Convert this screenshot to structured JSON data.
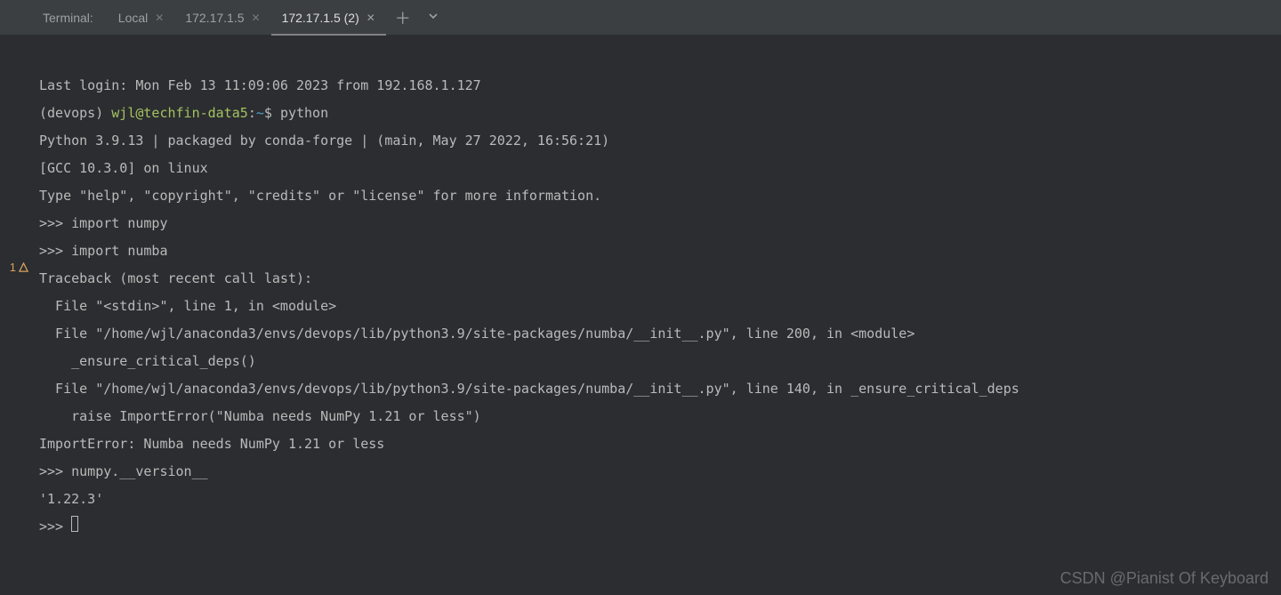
{
  "tabbar": {
    "label": "Terminal:",
    "tabs": [
      {
        "label": "Local"
      },
      {
        "label": "172.17.1.5"
      },
      {
        "label": "172.17.1.5 (2)"
      }
    ]
  },
  "gutter": {
    "count": "1"
  },
  "term": {
    "line1": "Last login: Mon Feb 13 11:09:06 2023 from 192.168.1.127",
    "prompt_env": "(devops) ",
    "prompt_userhost": "wjl@techfin-data5",
    "prompt_colon": ":",
    "prompt_path": "~",
    "prompt_dollar": "$ ",
    "cmd_python": "python",
    "py_version": "Python 3.9.13 | packaged by conda-forge | (main, May 27 2022, 16:56:21)",
    "py_gcc": "[GCC 10.3.0] on linux",
    "py_help": "Type \"help\", \"copyright\", \"credits\" or \"license\" for more information.",
    "repl1": ">>> import numpy",
    "repl2": ">>> import numba",
    "tb_head": "Traceback (most recent call last):",
    "tb_l1": "  File \"<stdin>\", line 1, in <module>",
    "tb_l2": "  File \"/home/wjl/anaconda3/envs/devops/lib/python3.9/site-packages/numba/__init__.py\", line 200, in <module>",
    "tb_l3": "    _ensure_critical_deps()",
    "tb_l4": "  File \"/home/wjl/anaconda3/envs/devops/lib/python3.9/site-packages/numba/__init__.py\", line 140, in _ensure_critical_deps",
    "tb_l5": "    raise ImportError(\"Numba needs NumPy 1.21 or less\")",
    "tb_err": "ImportError: Numba needs NumPy 1.21 or less",
    "repl3": ">>> numpy.__version__",
    "repl3_out": "'1.22.3'",
    "repl4": ">>> "
  },
  "watermark": "CSDN @Pianist Of Keyboard"
}
